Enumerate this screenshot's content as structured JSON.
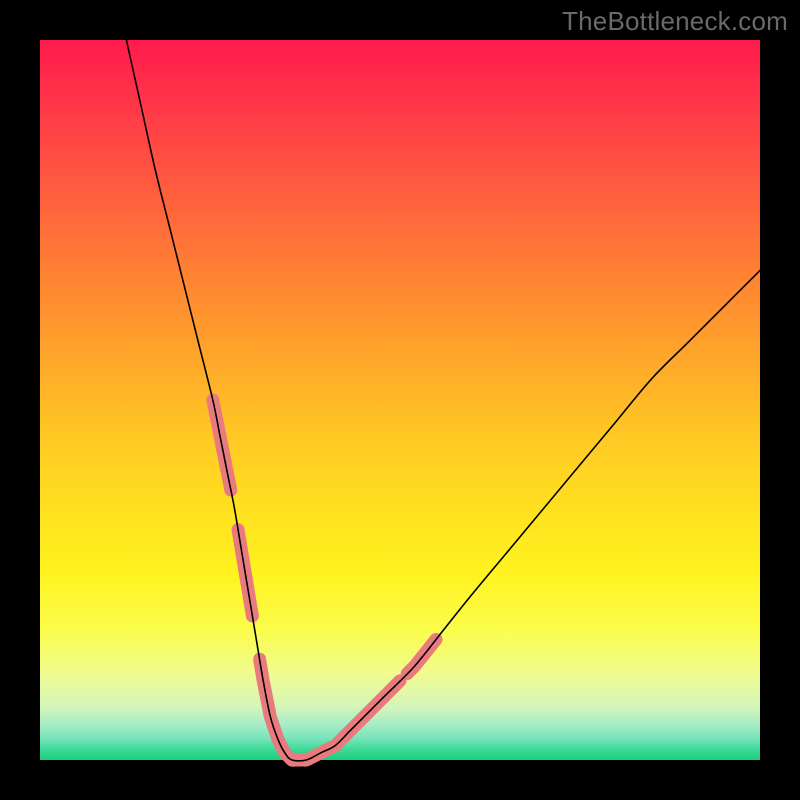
{
  "watermark": "TheBottleneck.com",
  "chart_data": {
    "type": "line",
    "title": "",
    "xlabel": "",
    "ylabel": "",
    "xlim": [
      0,
      100
    ],
    "ylim": [
      0,
      100
    ],
    "series": [
      {
        "name": "bottleneck-curve",
        "x": [
          12,
          14,
          16,
          18,
          20,
          22,
          24,
          25,
          26,
          27,
          28,
          29,
          30,
          31,
          32,
          33,
          34,
          35,
          37,
          39,
          41,
          43,
          45,
          48,
          52,
          56,
          60,
          65,
          70,
          75,
          80,
          85,
          90,
          95,
          100
        ],
        "y": [
          100,
          91,
          82,
          74,
          66,
          58,
          50,
          45,
          40,
          35,
          29,
          23,
          17,
          11,
          6,
          3,
          1,
          0,
          0,
          1,
          2,
          4,
          6,
          9,
          13,
          18,
          23,
          29,
          35,
          41,
          47,
          53,
          58,
          63,
          68
        ]
      }
    ],
    "highlight_segments": [
      {
        "name": "left-upper",
        "x_range": [
          24.0,
          26.5
        ]
      },
      {
        "name": "left-mid",
        "x_range": [
          27.5,
          29.5
        ]
      },
      {
        "name": "left-lower",
        "x_range": [
          30.5,
          33.5
        ]
      },
      {
        "name": "trough",
        "x_range": [
          33.5,
          42.5
        ]
      },
      {
        "name": "right-lower",
        "x_range": [
          42.5,
          50.0
        ]
      },
      {
        "name": "right-upper",
        "x_range": [
          51.0,
          55.0
        ]
      }
    ],
    "gradient_stops": [
      {
        "pos": 0,
        "color": "#ff1a4d"
      },
      {
        "pos": 0.44,
        "color": "#ffa62a"
      },
      {
        "pos": 0.74,
        "color": "#fff31f"
      },
      {
        "pos": 1.0,
        "color": "#17d07a"
      }
    ]
  }
}
